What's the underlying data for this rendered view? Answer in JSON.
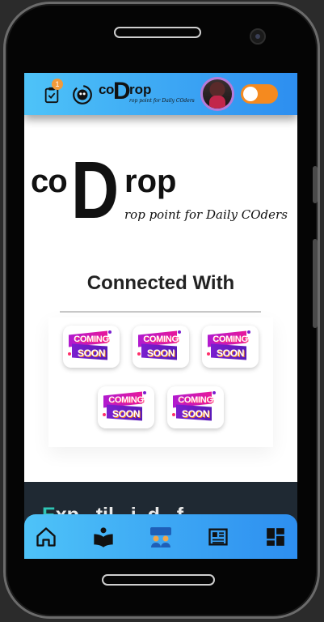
{
  "header": {
    "tasks_badge": "1",
    "logo": {
      "co": "co",
      "d": "D",
      "rop": "rop",
      "tagline": "rop point for Daily COders"
    },
    "theme_toggle_on": false,
    "colors": {
      "topbar_start": "#4ec3f8",
      "topbar_end": "#2d8ef0",
      "toggle": "#f58a1f"
    }
  },
  "hero_logo": {
    "co": "co",
    "d": "D",
    "rop": "rop",
    "tagline": "rop point for Daily COders"
  },
  "connected": {
    "heading": "Connected With",
    "partners": [
      {
        "line1": "COMING",
        "line2": "SOON"
      },
      {
        "line1": "COMING",
        "line2": "SOON"
      },
      {
        "line1": "COMING",
        "line2": "SOON"
      },
      {
        "line1": "COMING",
        "line2": "SOON"
      },
      {
        "line1": "COMING",
        "line2": "SOON"
      }
    ]
  },
  "teaser": {
    "accent": "E",
    "rest": "xp...til...i..d...f..."
  },
  "bottom_nav": {
    "items": [
      {
        "icon": "home-icon"
      },
      {
        "icon": "book-reader-icon"
      },
      {
        "icon": "group-icon",
        "active": true
      },
      {
        "icon": "newspaper-icon"
      },
      {
        "icon": "dashboard-icon"
      }
    ]
  }
}
